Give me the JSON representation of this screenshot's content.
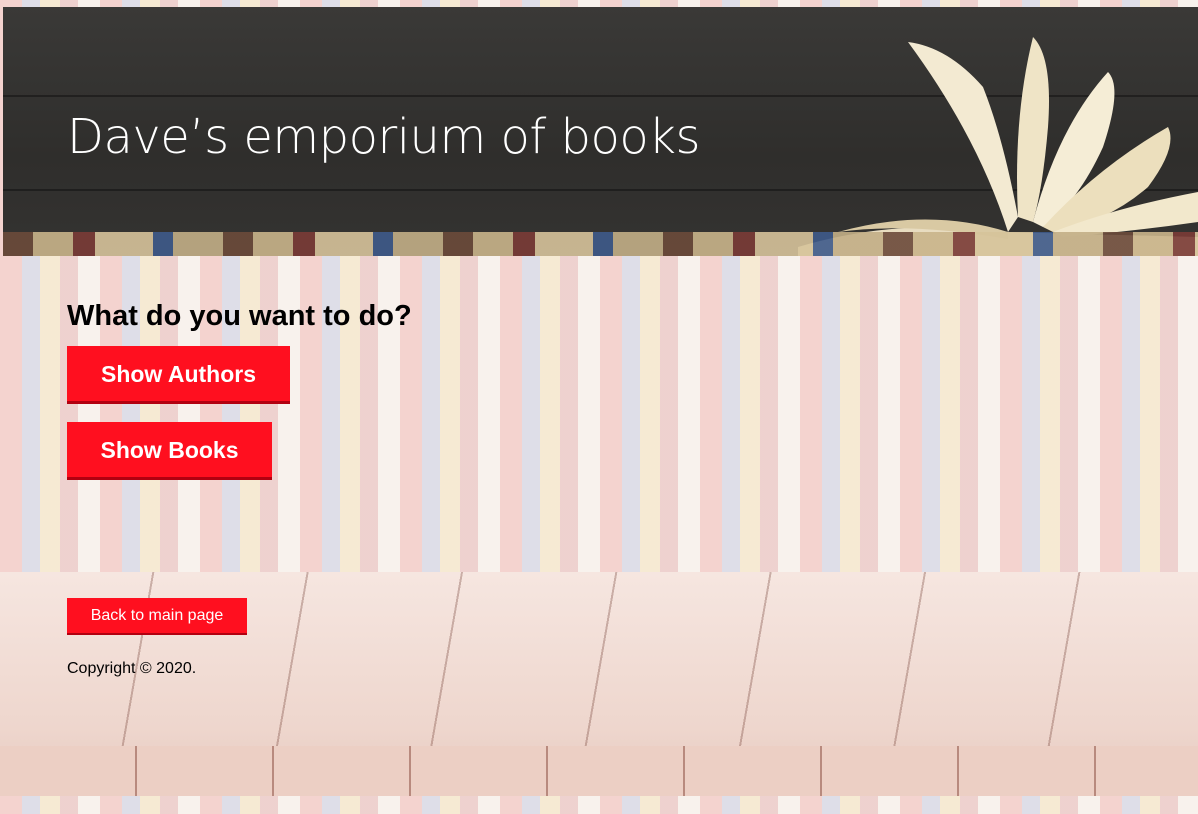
{
  "header": {
    "title": "Dave’s emporium of books"
  },
  "main": {
    "question": "What do you want to do?",
    "buttons": {
      "show_authors": "Show Authors",
      "show_books": "Show Books"
    }
  },
  "footer": {
    "back_link": "Back to main page",
    "copyright": "Copyright © 2020."
  },
  "colors": {
    "button_red": "#ff0f1f",
    "header_dark": "#2f2e2c",
    "text_white": "#ffffff"
  },
  "images": {
    "header_image": "open-book-on-chalkboard",
    "background_image": "blurred-bookshelf",
    "footer_image": "wooden-tabletop"
  }
}
